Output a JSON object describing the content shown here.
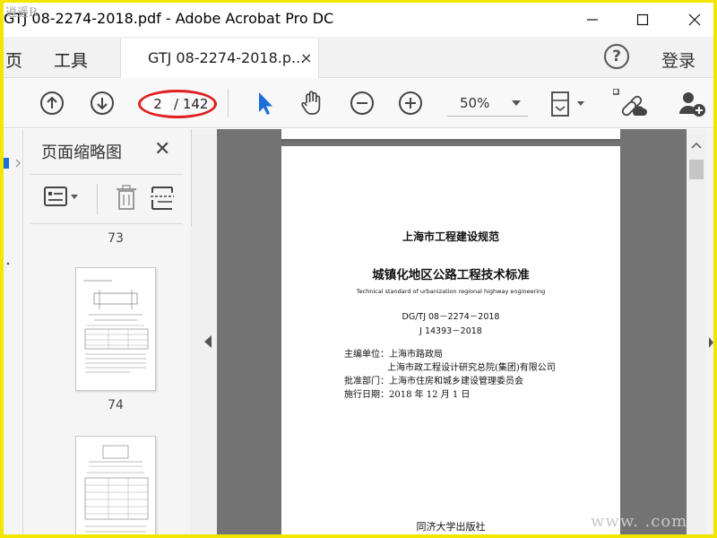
{
  "window": {
    "title": "GTJ 08-2274-2018.pdf - Adobe Acrobat Pro DC",
    "logo_text": "逍 遥 R"
  },
  "tabs": {
    "home_label": "页",
    "tools_label": "工具",
    "document_label": "GTJ 08-2274-2018.p...",
    "close_symbol": "×",
    "help_symbol": "?",
    "login_label": "登录"
  },
  "toolbar": {
    "current_page": "2",
    "total_pages": "/ 142",
    "zoom": "50%",
    "icons": [
      "arrow-up-circle-icon",
      "arrow-down-circle-icon",
      "select-cursor-icon",
      "hand-icon",
      "zoom-out-icon",
      "zoom-in-icon",
      "page-fit-icon",
      "share-link-icon",
      "add-user-icon"
    ],
    "annotation_color": "#e02020"
  },
  "thumbnails": {
    "panel_title": "页面缩略图",
    "close_symbol": "✕",
    "pages": [
      {
        "label": "73"
      },
      {
        "label": "74"
      }
    ]
  },
  "document": {
    "series": "上海市工程建设规范",
    "title_cn": "城镇化地区公路工程技术标准",
    "title_en": "Technical standard of urbanization regional highway engineering",
    "code1": "DG/TJ 08－2274－2018",
    "code2": "J 14393－2018",
    "editor_label": "主编单位：上海市路政局",
    "editor_line2": "上海市政工程设计研究总院(集团)有限公司",
    "approver": "批准部门：上海市住房和城乡建设管理委员会",
    "effective_date": "施行日期：2018 年 12 月 1 日",
    "publisher": "同济大学出版社"
  },
  "watermark": "www.          .com"
}
